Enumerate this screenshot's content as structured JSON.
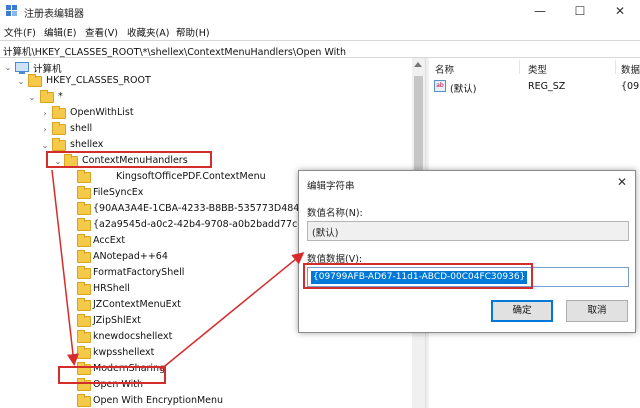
{
  "window": {
    "title": "注册表编辑器",
    "min_glyph": "—",
    "max_glyph": "☐",
    "close_glyph": "✕"
  },
  "menu": [
    "文件(F)",
    "编辑(E)",
    "查看(V)",
    "收藏夹(A)",
    "帮助(H)"
  ],
  "address": "计算机\\HKEY_CLASSES_ROOT\\*\\shellex\\ContextMenuHandlers\\Open With",
  "tree": {
    "computer": "计算机",
    "hkcr": "HKEY_CLASSES_ROOT",
    "star": "*",
    "openwithlist": "OpenWithList",
    "shell": "shell",
    "shellex": "shellex",
    "cmh": "ContextMenuHandlers",
    "children": [
      "KingsoftOfficePDF.ContextMenu",
      "FileSyncEx",
      "{90AA3A4E-1CBA-4233-B8BB-535773D48449}",
      "{a2a9545d-a0c2-42b4-9708-a0b2badd77c8}",
      "AccExt",
      "ANotepad++64",
      "FormatFactoryShell",
      "HRShell",
      "JZContextMenuExt",
      "JZipShlExt",
      "knewdocshellext",
      "kwpsshellext",
      "ModernSharing",
      "Open With",
      "Open With EncryptionMenu"
    ]
  },
  "list": {
    "col_name": "名称",
    "col_type": "类型",
    "col_data": "数据",
    "value_icon": "ab",
    "rows": [
      {
        "name": "(默认)",
        "type": "REG_SZ",
        "data": "{09"
      }
    ]
  },
  "dialog": {
    "title": "编辑字符串",
    "close_glyph": "✕",
    "name_label": "数值名称(N):",
    "name_value": "(默认)",
    "data_label": "数值数据(V):",
    "data_value": "{09799AFB-AD67-11d1-ABCD-00C04FC30936}",
    "ok": "确定",
    "cancel": "取消"
  },
  "colors": {
    "highlight_box": "#d62c2c",
    "selection": "#0078d7",
    "folder": "#f5c94a"
  }
}
